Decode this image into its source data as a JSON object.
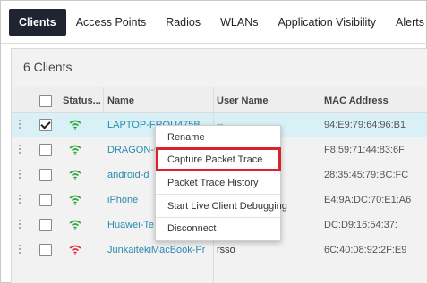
{
  "tabs": [
    {
      "label": "Clients",
      "active": true
    },
    {
      "label": "Access Points"
    },
    {
      "label": "Radios"
    },
    {
      "label": "WLANs"
    },
    {
      "label": "Application Visibility"
    },
    {
      "label": "Alerts"
    }
  ],
  "panel_title": "6 Clients",
  "columns": {
    "status": "Status...",
    "name": "Name",
    "user": "User Name",
    "mac": "MAC Address"
  },
  "rows": [
    {
      "name": "LAPTOP-FROU475B",
      "user": "--",
      "mac": "94:E9:79:64:96:B1",
      "checked": true,
      "signal": "good"
    },
    {
      "name": "DRAGON-C",
      "user": "",
      "mac": "F8:59:71:44:83:6F",
      "checked": false,
      "signal": "good"
    },
    {
      "name": "android-d",
      "user": "",
      "mac": "28:35:45:79:BC:FC",
      "checked": false,
      "signal": "good"
    },
    {
      "name": "iPhone",
      "user": "",
      "mac": "E4:9A:DC:70:E1:A6",
      "checked": false,
      "signal": "good"
    },
    {
      "name": "Huawei-Te",
      "user": "",
      "mac": "DC:D9:16:54:37:",
      "checked": false,
      "signal": "good"
    },
    {
      "name": "JunkaitekiMacBook-Pr",
      "user": "rsso",
      "mac": "6C:40:08:92:2F:E9",
      "checked": false,
      "signal": "poor"
    }
  ],
  "context_menu": {
    "items": [
      "Rename",
      "Capture Packet Trace",
      "Packet Trace History",
      "Start Live Client Debugging",
      "Disconnect"
    ],
    "highlighted": "Capture Packet Trace"
  },
  "colors": {
    "tab_active_bg": "#1f2430",
    "link": "#2a8bb0",
    "selected_row": "#d9f1f6",
    "highlight_box": "#d8232a",
    "signal_good": "#2aa63a",
    "signal_poor": "#e0303a"
  }
}
